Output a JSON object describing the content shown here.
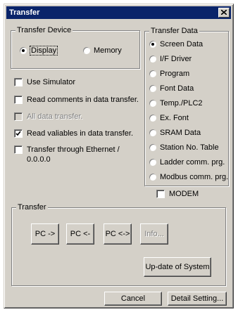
{
  "window": {
    "title": "Transfer"
  },
  "transfer_device": {
    "legend": "Transfer Device",
    "options": [
      {
        "label": "Display",
        "selected": true
      },
      {
        "label": "Memory",
        "selected": false
      }
    ]
  },
  "options": {
    "use_simulator": {
      "label": "Use Simulator",
      "checked": false
    },
    "read_comments": {
      "label": "Read comments in data transfer.",
      "checked": false
    },
    "all_data_transfer": {
      "label": "All data transfer.",
      "checked": false,
      "disabled": true
    },
    "read_variables": {
      "label": "Read valiables in data transfer.",
      "checked": true
    },
    "ethernet": {
      "label_line1": "Transfer through Ethernet /",
      "label_line2": "0.0.0.0",
      "checked": false
    }
  },
  "transfer_data": {
    "legend": "Transfer Data",
    "options": [
      {
        "label": "Screen Data",
        "selected": true
      },
      {
        "label": "I/F Driver",
        "selected": false
      },
      {
        "label": "Program",
        "selected": false
      },
      {
        "label": "Font Data",
        "selected": false
      },
      {
        "label": "Temp./PLC2",
        "selected": false
      },
      {
        "label": "Ex. Font",
        "selected": false
      },
      {
        "label": "SRAM Data",
        "selected": false
      },
      {
        "label": "Station No. Table",
        "selected": false
      },
      {
        "label": "Ladder comm. prg.",
        "selected": false
      },
      {
        "label": "Modbus comm. prg.",
        "selected": false
      }
    ]
  },
  "modem": {
    "label": "MODEM",
    "checked": false
  },
  "transfer_group": {
    "legend": "Transfer",
    "pc_to": "PC ->",
    "pc_from": "PC <-",
    "pc_both": "PC <->",
    "info": "Info...",
    "update_system": "Up-date of System"
  },
  "footer": {
    "cancel": "Cancel",
    "detail_setting": "Detail Setting..."
  },
  "colors": {
    "titlebar": "#0a246a",
    "face": "#d4d0c8"
  }
}
